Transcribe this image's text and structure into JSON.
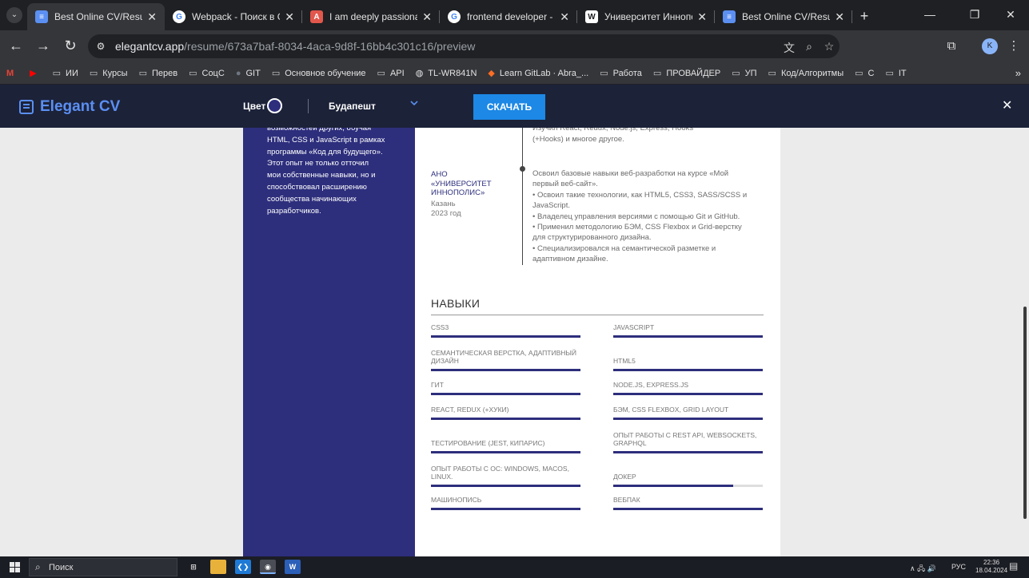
{
  "browser": {
    "tabs": [
      {
        "title": "Best Online CV/Resume",
        "icon": "elegantcv-favicon",
        "color": "#5b8ff2",
        "active": true
      },
      {
        "title": "Webpack - Поиск в Go",
        "icon": "google-favicon",
        "color": "#ffffff",
        "active": false
      },
      {
        "title": "I am deeply passionate",
        "icon": "pdf-favicon",
        "color": "#e2574c",
        "active": false
      },
      {
        "title": "frontend developer - П",
        "icon": "google-favicon",
        "color": "#ffffff",
        "active": false
      },
      {
        "title": "Университет Иннопол",
        "icon": "wikipedia-favicon",
        "color": "#ffffff",
        "active": false
      },
      {
        "title": "Best Online CV/Resume",
        "icon": "elegantcv-favicon",
        "color": "#5b8ff2",
        "active": false
      }
    ],
    "url_host": "elegantcv.app",
    "url_path": "/resume/673a7baf-8034-4aca-9d8f-16bb4c301c16/preview",
    "profile_initial": "K",
    "bookmarks": [
      {
        "label": "",
        "icon": "gmail-icon"
      },
      {
        "label": "",
        "icon": "youtube-icon"
      },
      {
        "label": "ИИ",
        "icon": "folder-icon"
      },
      {
        "label": "Курсы",
        "icon": "folder-icon"
      },
      {
        "label": "Перев",
        "icon": "folder-icon"
      },
      {
        "label": "СоцС",
        "icon": "folder-icon"
      },
      {
        "label": "GIT",
        "icon": "github-icon"
      },
      {
        "label": "Основное обучение",
        "icon": "folder-icon"
      },
      {
        "label": "API",
        "icon": "folder-icon"
      },
      {
        "label": "TL-WR841N",
        "icon": "globe-icon"
      },
      {
        "label": "Learn GitLab · Abra_...",
        "icon": "gitlab-icon"
      },
      {
        "label": "Работа",
        "icon": "folder-icon"
      },
      {
        "label": "ПРОВАЙДЕР",
        "icon": "folder-icon"
      },
      {
        "label": "УП",
        "icon": "folder-icon"
      },
      {
        "label": "Код/Алгоритмы",
        "icon": "folder-icon"
      },
      {
        "label": "С",
        "icon": "folder-icon"
      },
      {
        "label": "IT",
        "icon": "folder-icon"
      }
    ]
  },
  "app": {
    "logo": "Elegant CV",
    "color_label": "Цвет",
    "selected_color": "#2d2e7c",
    "template_name": "Будапешт",
    "download_label": "СКАЧАТЬ"
  },
  "resume": {
    "accent_color": "#2d2e7c",
    "about_lines": [
      "возможностей других, обучая",
      "HTML, CSS и JavaScript в рамках",
      "программы «Код для будущего».",
      "Этот опыт не только отточил",
      "мои собственные навыки, но и",
      "способствовал расширению",
      "сообщества начинающих",
      "разработчиков."
    ],
    "previous_desc_lines": [
      "Изучил React, Redux, Node.js, Express, Hooks",
      "(+Hooks) и многое другое."
    ],
    "education": {
      "org_lines": [
        "АНО",
        "«УНИВЕРСИТЕТ",
        "ИННОПОЛИС»"
      ],
      "city": "Казань",
      "year": "2023 год",
      "desc_lines": [
        "Освоил базовые навыки веб-разработки на курсе «Мой",
        "первый веб-сайт».",
        "• Освоил такие технологии, как HTML5, CSS3, SASS/SCSS и",
        "JavaScript.",
        "• Владелец управления версиями с помощью Git и GitHub.",
        "• Применил методологию БЭМ, CSS Flexbox и Grid-верстку",
        "для структурированного дизайна.",
        "• Специализировался на семантической разметке и",
        "адаптивном дизайне."
      ]
    },
    "skills_title": "НАВЫКИ",
    "skills": [
      {
        "name": "CSS3",
        "level": 1.0
      },
      {
        "name": "JAVASCRIPT",
        "level": 1.0
      },
      {
        "name": "СЕМАНТИЧЕСКАЯ ВЕРСТКА, АДАПТИВНЫЙ ДИЗАЙН",
        "level": 1.0
      },
      {
        "name": "HTML5",
        "level": 1.0
      },
      {
        "name": "ГИТ",
        "level": 1.0
      },
      {
        "name": "NODE.JS, EXPRESS.JS",
        "level": 1.0
      },
      {
        "name": "REACT, REDUX (+ХУКИ)",
        "level": 1.0
      },
      {
        "name": "БЭМ, CSS FLEXBOX, GRID LAYOUT",
        "level": 1.0
      },
      {
        "name": "ТЕСТИРОВАНИЕ (JEST, КИПАРИС)",
        "level": 1.0
      },
      {
        "name": "ОПЫТ РАБОТЫ С REST API, WEBSOCKETS, GRAPHQL",
        "level": 1.0
      },
      {
        "name": "ОПЫТ РАБОТЫ С ОС: WINDOWS, MACOS, LINUX.",
        "level": 1.0
      },
      {
        "name": "ДОКЕР",
        "level": 0.8
      },
      {
        "name": "МАШИНОПИСЬ",
        "level": 1.0
      },
      {
        "name": "ВЕБПАК",
        "level": 1.0
      }
    ]
  },
  "taskbar": {
    "search_placeholder": "Поиск",
    "tray_lang": "РУС",
    "time": "22:36",
    "date": "18.04.2024",
    "notifications": "2"
  }
}
